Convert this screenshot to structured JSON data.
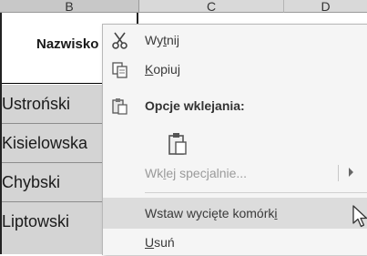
{
  "columns": {
    "b": "B",
    "c": "C",
    "d": "D"
  },
  "cells": {
    "header": "Nazwisko",
    "rows": [
      "Ustroński",
      "Kisielowska",
      "Chybski",
      "Liptowski"
    ]
  },
  "menu": {
    "cut": {
      "pre": "Wy",
      "acc": "t",
      "post": "nij",
      "icon": "scissors-icon"
    },
    "copy": {
      "acc": "K",
      "post": "opiuj",
      "icon": "copy-icon"
    },
    "paste_options": {
      "label": "Opcje wklejania:",
      "icon": "paste-icon"
    },
    "paste_icon_button": {
      "icon": "paste-clipboard-icon"
    },
    "paste_special": {
      "pre": "Wk",
      "acc": "l",
      "post": "ej specjalnie...",
      "icon": "chevron-right-icon"
    },
    "insert_cut": {
      "pre": "Wstaw wycięte komórk",
      "acc": "i"
    },
    "delete": {
      "acc": "U",
      "post": "suń"
    }
  },
  "colors": {
    "menu_bg": "#f5f5f5",
    "hover_bg": "#dcdcdc",
    "cell_bg": "#d4d4d4",
    "header_bg": "#d9d9d9"
  },
  "cursor": {
    "icon": "mouse-pointer-icon"
  }
}
